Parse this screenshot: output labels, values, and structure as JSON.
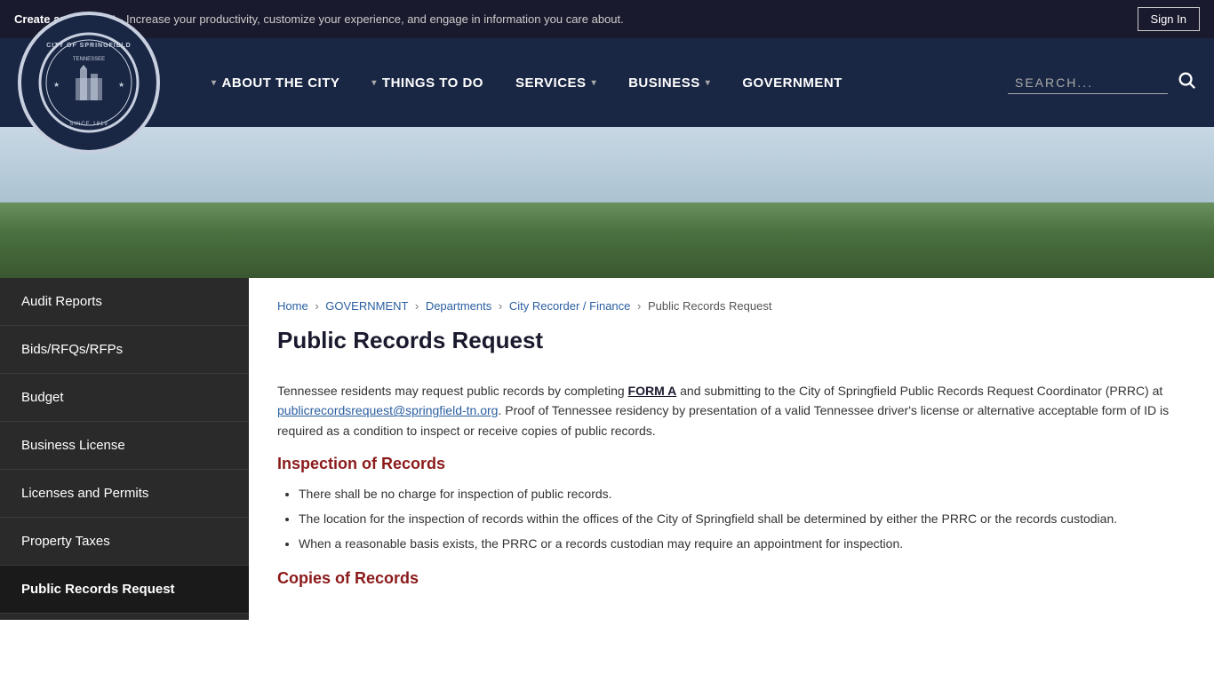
{
  "top_banner": {
    "create_account_label": "Create an Account",
    "banner_text": " - Increase your productivity, customize your experience, and engage in information you care about.",
    "sign_in_label": "Sign In"
  },
  "nav": {
    "about_label": "ABOUT THE CITY",
    "things_label": "THINGS TO DO",
    "services_label": "SERVICES",
    "business_label": "BUSINESS",
    "government_label": "GOVERNMENT",
    "search_placeholder": "SEARCH..."
  },
  "sidebar": {
    "items": [
      {
        "label": "Audit Reports",
        "active": false
      },
      {
        "label": "Bids/RFQs/RFPs",
        "active": false
      },
      {
        "label": "Budget",
        "active": false
      },
      {
        "label": "Business License",
        "active": false
      },
      {
        "label": "Licenses and Permits",
        "active": false
      },
      {
        "label": "Property Taxes",
        "active": false
      },
      {
        "label": "Public Records Request",
        "active": true
      }
    ]
  },
  "breadcrumb": {
    "home": "Home",
    "government": "GOVERNMENT",
    "departments": "Departments",
    "recorder_finance": "City Recorder / Finance",
    "current": "Public Records Request"
  },
  "page": {
    "title": "Public Records Request",
    "intro": "Tennessee residents may request public records by completing ",
    "form_a": "FORM A",
    "intro2": " and submitting to the City of Springfield Public Records Request Coordinator (PRRC) at ",
    "email": "publicrecordsrequest@springfield-tn.org",
    "intro3": ".  Proof of Tennessee residency by presentation of a valid Tennessee driver's license or alternative acceptable form of ID is required as a condition to inspect or receive copies of public records.",
    "inspection_heading": "Inspection of Records",
    "inspection_items": [
      "There shall be no charge for inspection of public records.",
      "The location for the inspection of records within the offices of the City of Springfield shall be determined by either the PRRC or the records custodian.",
      "When a reasonable basis exists, the PRRC or a records custodian may require an appointment for inspection."
    ],
    "copies_heading": "Copies of Records"
  },
  "logo": {
    "city_name": "CITY OF SPRINGFIELD",
    "state": "TENNESSEE",
    "since": "SINCE 1819"
  }
}
